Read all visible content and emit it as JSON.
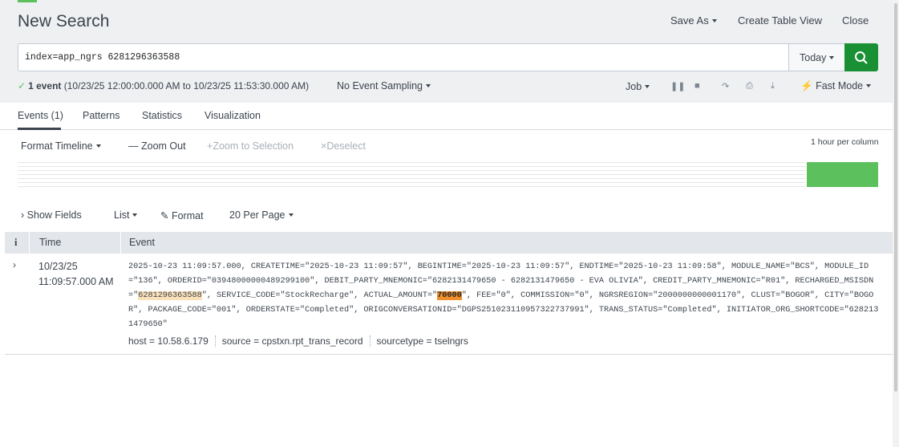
{
  "header": {
    "title": "New Search",
    "save_as": "Save As",
    "create_table_view": "Create Table View",
    "close": "Close"
  },
  "search": {
    "query": "index=app_ngrs 6281296363588",
    "time_range": "Today",
    "search_icon": "search-icon"
  },
  "status": {
    "count": "1 event",
    "range": "(10/23/25 12:00:00.000 AM to 10/23/25 11:53:30.000 AM)",
    "sampling": "No Event Sampling",
    "job": "Job",
    "mode": "Fast Mode"
  },
  "tabs": [
    {
      "label": "Events (1)"
    },
    {
      "label": "Patterns"
    },
    {
      "label": "Statistics"
    },
    {
      "label": "Visualization"
    }
  ],
  "timeline": {
    "format": "Format Timeline",
    "zoom_out": "Zoom Out",
    "zoom_selection": "Zoom to Selection",
    "deselect": "Deselect",
    "per_column": "1 hour per column"
  },
  "fields_bar": {
    "show_fields": "Show Fields",
    "list": "List",
    "format": "Format",
    "per_page": "20 Per Page"
  },
  "table": {
    "info_header": "i",
    "time_header": "Time",
    "event_header": "Event",
    "row": {
      "date": "10/23/25",
      "time": "11:09:57.000 AM",
      "raw_1": "2025-10-23 11:09:57.000, CREATETIME=\"2025-10-23 11:09:57\", BEGINTIME=\"2025-10-23 11:09:57\", ENDTIME=\"2025-10-23 11:09:58\", MODULE_NAME=\"BCS\", MODULE_ID=\"136\", ORDERID=\"03948000000489299100\", DEBIT_PARTY_MNEMONIC=\"6282131479650 - 6282131479650 - EVA OLIVIA\", CREDIT_PARTY_MNEMONIC=\"R01\", RECHARGED_MSISDN=\"",
      "msisdn": "6281296363588",
      "raw_2": "\", SERVICE_CODE=\"StockRecharge\", ACTUAL_AMOUNT=\"",
      "amount": "70000",
      "raw_3": "\", FEE=\"0\", COMMISSION=\"0\", NGRSREGION=\"2000000000001170\", CLUST=\"BOGOR\", CITY=\"BOGOR\", PACKAGE_CODE=\"001\", ORDERSTATE=\"Completed\", ORIGCONVERSATIONID=\"DGPS251023110957322737991\", TRANS_STATUS=\"Completed\", INITIATOR_ORG_SHORTCODE=\"6282131479650\"",
      "host": "host = 10.58.6.179",
      "source": "source = cpstxn.rpt_trans_record",
      "sourcetype": "sourcetype = tselngrs"
    }
  },
  "colors": {
    "accent_green": "#1a9035",
    "timeline_green": "#5cc05c",
    "highlight": "#f08f2c"
  }
}
